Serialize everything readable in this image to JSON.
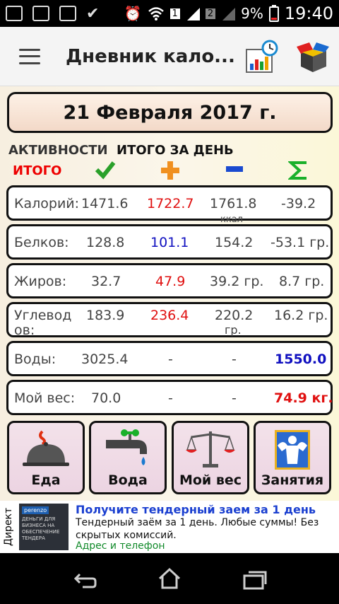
{
  "status": {
    "battery": "9%",
    "time": "19:40",
    "sim1": "1",
    "sim2": "2"
  },
  "appbar": {
    "title": "Дневник кало..."
  },
  "date": "21 Февраля 2017 г.",
  "headers": {
    "activities": "АКТИВНОСТИ",
    "total_day": "ИТОГО ЗА ДЕНЬ",
    "total": "ИТОГО"
  },
  "rows": [
    {
      "label": "Калорий:",
      "a": "1471.6",
      "b": "1722.7",
      "c": "1761.8",
      "c2": "ккал",
      "d": "-39.2"
    },
    {
      "label": "Белков:",
      "a": "128.8",
      "b": "101.1",
      "c": "154.2",
      "d": "-53.1 гр."
    },
    {
      "label": "Жиров:",
      "a": "32.7",
      "b": "47.9",
      "c": "39.2 гр.",
      "d": "8.7 гр."
    },
    {
      "label": "Углевод",
      "label2": "ов:",
      "a": "183.9",
      "b": "236.4",
      "c": "220.2",
      "c2": "гр.",
      "d": "16.2 гр."
    },
    {
      "label": "Воды:",
      "a": "3025.4",
      "b": "-",
      "c": "-",
      "d": "1550.0"
    },
    {
      "label": "Мой вес:",
      "a": "70.0",
      "b": "-",
      "c": "-",
      "d": "74.9 кг."
    }
  ],
  "buttons": {
    "food": "Еда",
    "water": "Вода",
    "weight": "Мой вес",
    "sport": "Занятия"
  },
  "ad": {
    "side": "Директ",
    "img_tag": "perenzo",
    "img_text": "ДЕНЬГИ ДЛЯ БИЗНЕСА НА ОБЕСПЕЧЕНИЕ ТЕНДЕРА",
    "title": "Получите тендерный заем за 1 день",
    "text": "Тендерный заём за 1 день. Любые суммы! Без скрытых комиссий.",
    "link": "Адрес и телефон"
  }
}
